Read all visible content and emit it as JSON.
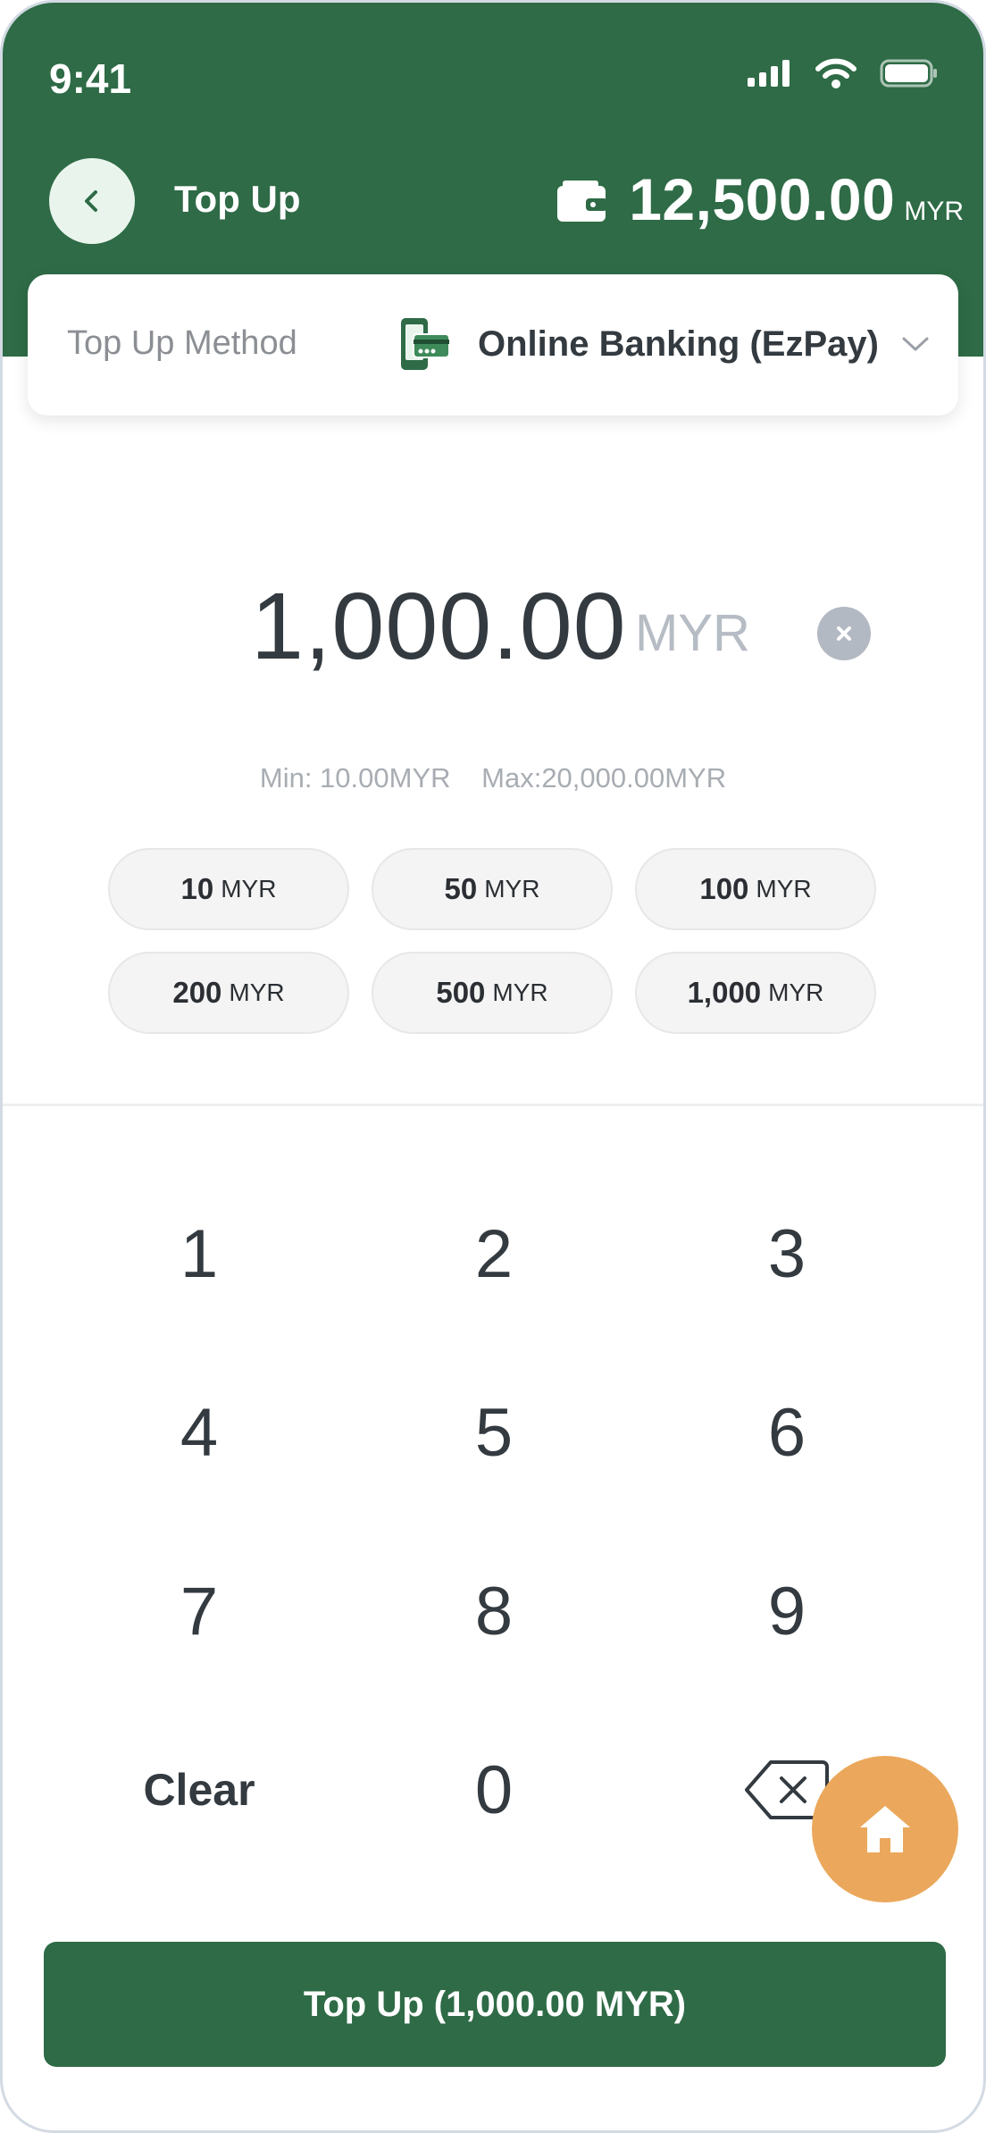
{
  "status_bar": {
    "time": "9:41",
    "icons": [
      "signal-icon",
      "wifi-icon",
      "battery-icon"
    ]
  },
  "header": {
    "title": "Top Up",
    "balance_amount": "12,500.00",
    "balance_currency": "MYR",
    "back_icon": "chevron-left-icon",
    "wallet_icon": "wallet-icon"
  },
  "method": {
    "label": "Top Up Method",
    "value": "Online Banking (EzPay)",
    "icon": "mobile-banking-icon"
  },
  "amount": {
    "value": "1,000.00",
    "currency": "MYR"
  },
  "limits": {
    "min": "Min: 10.00MYR",
    "max": "Max:20,000.00MYR"
  },
  "presets": [
    {
      "value": "10",
      "currency": "MYR"
    },
    {
      "value": "50",
      "currency": "MYR"
    },
    {
      "value": "100",
      "currency": "MYR"
    },
    {
      "value": "200",
      "currency": "MYR"
    },
    {
      "value": "500",
      "currency": "MYR"
    },
    {
      "value": "1,000",
      "currency": "MYR"
    }
  ],
  "keypad": {
    "keys": [
      "1",
      "2",
      "3",
      "4",
      "5",
      "6",
      "7",
      "8",
      "9"
    ],
    "clear": "Clear",
    "zero": "0",
    "backspace_icon": "backspace-icon"
  },
  "fab": {
    "icon": "home-icon"
  },
  "submit": {
    "label": "Top Up (1,000.00 MYR)"
  },
  "colors": {
    "brand_green": "#2e6b46",
    "accent_orange": "#eba85c",
    "text_dark": "#333a40",
    "text_muted": "#a8adb3"
  }
}
